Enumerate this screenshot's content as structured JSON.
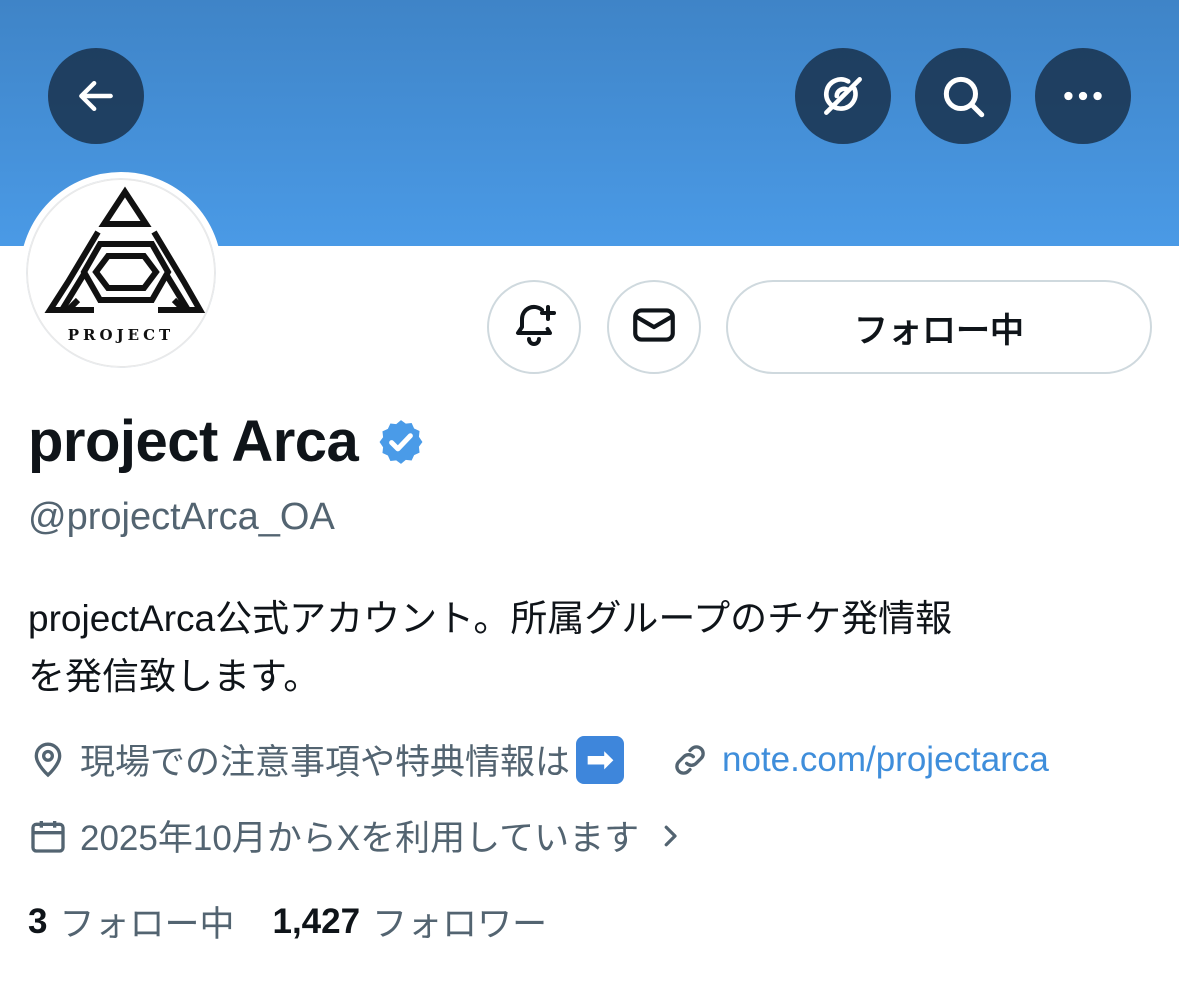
{
  "header": {
    "back_icon": "arrow-left-icon",
    "grok_icon": "grok-icon",
    "search_icon": "search-icon",
    "more_icon": "more-horizontal-icon"
  },
  "avatar": {
    "logo_text": "PROJECT"
  },
  "actions": {
    "notify_icon": "bell-plus-icon",
    "message_icon": "envelope-icon",
    "follow_label": "フォロー中"
  },
  "profile": {
    "display_name": "project Arca",
    "verified": true,
    "handle": "@projectArca_OA",
    "bio_line1": "projectArca公式アカウント。所属グループのチケ発情報",
    "bio_line2": "を発信致します。",
    "location": "現場での注意事項や特典情報は",
    "location_emoji": "➡",
    "website": "note.com/projectarca",
    "joined": "2025年10月からXを利用しています"
  },
  "stats": {
    "following_count": "3",
    "following_label": "フォロー中",
    "followers_count": "1,427",
    "followers_label": "フォロワー"
  },
  "colors": {
    "banner_top": "#3f84c7",
    "banner_bottom": "#4a9ae6",
    "verified_blue": "#4a9be8",
    "link_blue": "#3f8edb",
    "text_primary": "#0f1419",
    "text_secondary": "#536471"
  }
}
